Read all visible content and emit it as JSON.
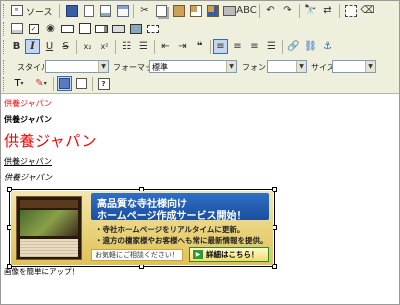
{
  "toolbar": {
    "row1": {
      "source_label": "ソース"
    },
    "row4": {
      "style_label": "スタイル",
      "style_value": "",
      "format_label": "フォーマット",
      "format_value": "標準",
      "font_label": "フォント",
      "font_value": "",
      "size_label": "サイズ",
      "size_value": ""
    },
    "row5": {
      "help_icon": "?"
    }
  },
  "content": {
    "line_red": "供養ジャパン",
    "line_bold": "供養ジャパン",
    "line_large": "供養ジャパン",
    "line_underline": "供養ジャパン",
    "line_italic": "供養ジャパン",
    "caption": "画像を簡単にアップ！"
  },
  "banner": {
    "title_line1": "高品質な寺社様向け",
    "title_line2": "ホームページ作成サービス開始！",
    "bullet1": "・寺社ホームページをリアルタイムに更新。",
    "bullet2": "・遠方の檀家様やお客様へも常に最新情報を提供。",
    "contact": "お気軽にご相談ください！",
    "details": "詳細はこちら！",
    "details_icon": "▶"
  },
  "colors": {
    "toolbar_bg": "#efefde",
    "red_text": "#ff0000",
    "banner_blue": "#1a4f9e",
    "banner_gold": "#e8d27a"
  }
}
